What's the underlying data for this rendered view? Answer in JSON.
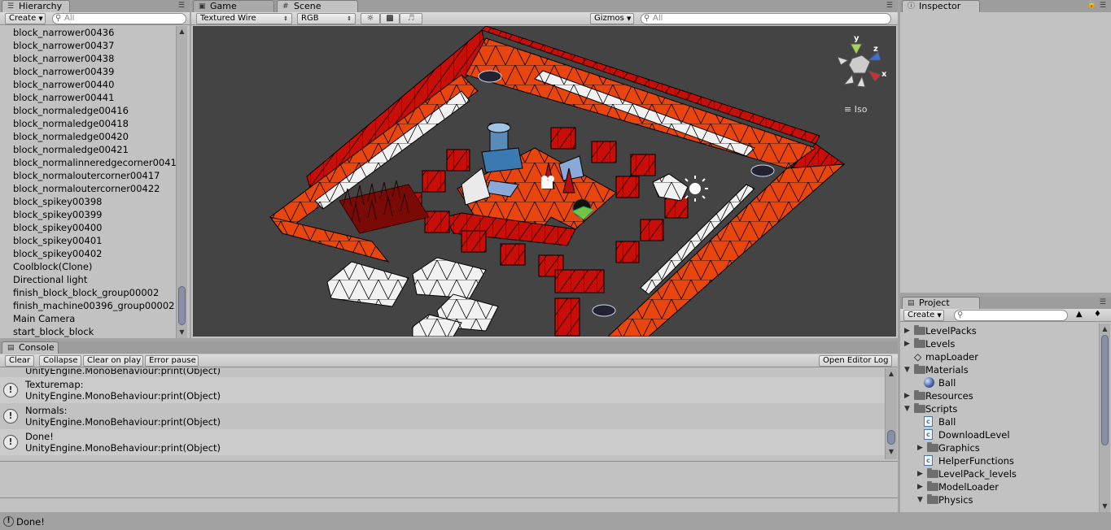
{
  "hierarchy": {
    "tab": "Hierarchy",
    "create": "Create",
    "search_placeholder": "All",
    "items": [
      "block_narrower00436",
      "block_narrower00437",
      "block_narrower00438",
      "block_narrower00439",
      "block_narrower00440",
      "block_narrower00441",
      "block_normaledge00416",
      "block_normaledge00418",
      "block_normaledge00420",
      "block_normaledge00421",
      "block_normalinneredgecorner0041",
      "block_normaloutercorner00417",
      "block_normaloutercorner00422",
      "block_spikey00398",
      "block_spikey00399",
      "block_spikey00400",
      "block_spikey00401",
      "block_spikey00402",
      "Coolblock(Clone)",
      "Directional light",
      "finish_block_block_group00002",
      "finish_machine00396_group00002",
      "Main Camera",
      "start_block_block"
    ]
  },
  "scene": {
    "tab_game": "Game",
    "tab_scene": "Scene",
    "render_mode": "Textured Wire",
    "color_mode": "RGB",
    "gizmos": "Gizmos",
    "search_placeholder": "All",
    "iso_label": "Iso",
    "axis_y": "y",
    "axis_z": "z",
    "axis_x": "x"
  },
  "console": {
    "tab": "Console",
    "buttons": {
      "clear": "Clear",
      "collapse": "Collapse",
      "clear_on_play": "Clear on play",
      "error_pause": "Error pause",
      "open_editor_log": "Open Editor Log"
    },
    "partial_line": "UnityEngine.MonoBehaviour:print(Object)",
    "entries": [
      {
        "title": "Texturemap:",
        "detail": "UnityEngine.MonoBehaviour:print(Object)"
      },
      {
        "title": "Normals:",
        "detail": "UnityEngine.MonoBehaviour:print(Object)"
      },
      {
        "title": "Done!",
        "detail": "UnityEngine.MonoBehaviour:print(Object)"
      }
    ]
  },
  "inspector": {
    "tab": "Inspector"
  },
  "project": {
    "tab": "Project",
    "create": "Create",
    "items": [
      {
        "label": "LevelPacks",
        "kind": "folder",
        "depth": 0,
        "expanded": false
      },
      {
        "label": "Levels",
        "kind": "folder",
        "depth": 0,
        "expanded": false
      },
      {
        "label": "mapLoader",
        "kind": "unity",
        "depth": 0
      },
      {
        "label": "Materials",
        "kind": "folder",
        "depth": 0,
        "expanded": true
      },
      {
        "label": "Ball",
        "kind": "material",
        "depth": 1
      },
      {
        "label": "Resources",
        "kind": "folder",
        "depth": 0,
        "expanded": false
      },
      {
        "label": "Scripts",
        "kind": "folder",
        "depth": 0,
        "expanded": true
      },
      {
        "label": "Ball",
        "kind": "script",
        "depth": 1
      },
      {
        "label": "DownloadLevel",
        "kind": "script",
        "depth": 1
      },
      {
        "label": "Graphics",
        "kind": "folder",
        "depth": 1,
        "expanded": false
      },
      {
        "label": "HelperFunctions",
        "kind": "script",
        "depth": 1
      },
      {
        "label": "LevelPack_levels",
        "kind": "folder",
        "depth": 1,
        "expanded": false
      },
      {
        "label": "ModelLoader",
        "kind": "folder",
        "depth": 1,
        "expanded": false
      },
      {
        "label": "Physics",
        "kind": "folder",
        "depth": 1,
        "expanded": true
      }
    ]
  },
  "status": {
    "text": "Done!"
  },
  "colors": {
    "scene_bg": "#444444",
    "block_orange": "#e8450f",
    "block_red": "#c80e08",
    "block_white": "#f2f2f2",
    "panel": "#c2c2c2"
  }
}
